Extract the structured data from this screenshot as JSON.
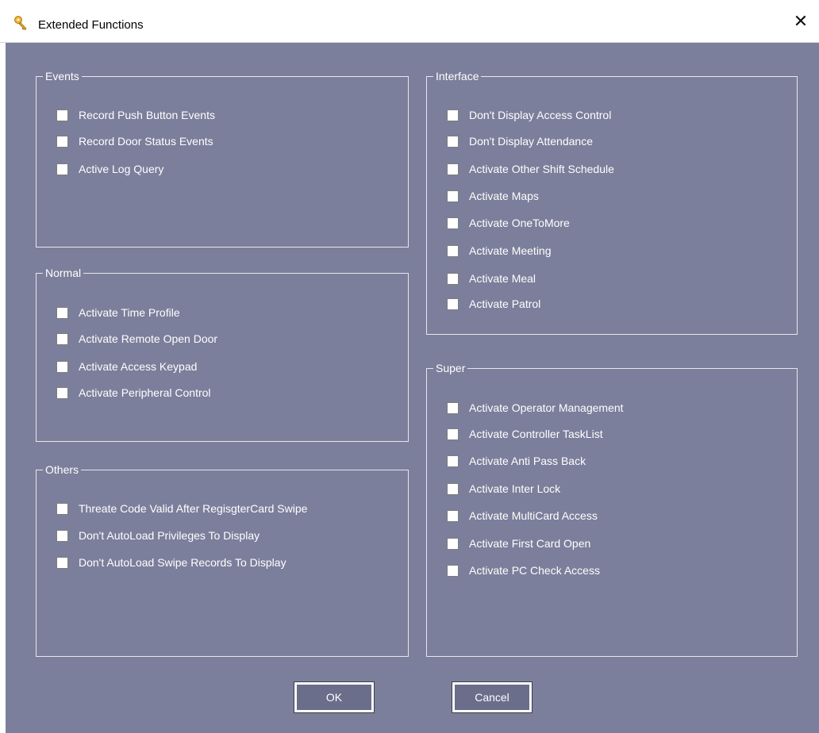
{
  "window": {
    "title": "Extended Functions",
    "close_glyph": "✕"
  },
  "groups": {
    "events": {
      "title": "Events",
      "items": [
        {
          "label": "Record Push Button Events",
          "checked": false
        },
        {
          "label": "Record Door Status Events",
          "checked": false
        },
        {
          "label": "Active Log Query",
          "checked": false
        }
      ]
    },
    "normal": {
      "title": "Normal",
      "items": [
        {
          "label": "Activate Time Profile",
          "checked": false
        },
        {
          "label": "Activate Remote Open Door",
          "checked": false
        },
        {
          "label": "Activate Access Keypad",
          "checked": false
        },
        {
          "label": "Activate Peripheral Control",
          "checked": false
        }
      ]
    },
    "others": {
      "title": "Others",
      "items": [
        {
          "label": "Threate Code Valid After RegisgterCard Swipe",
          "checked": false
        },
        {
          "label": "Don't AutoLoad Privileges To Display",
          "checked": false
        },
        {
          "label": "Don't AutoLoad Swipe Records To Display",
          "checked": false
        }
      ]
    },
    "interface": {
      "title": "Interface",
      "items": [
        {
          "label": "Don't Display Access Control",
          "checked": false
        },
        {
          "label": "Don't Display Attendance",
          "checked": false
        },
        {
          "label": "Activate Other Shift Schedule",
          "checked": false
        },
        {
          "label": "Activate Maps",
          "checked": false
        },
        {
          "label": "Activate OneToMore",
          "checked": false
        },
        {
          "label": "Activate Meeting",
          "checked": false
        },
        {
          "label": "Activate Meal",
          "checked": false
        },
        {
          "label": "Activate Patrol",
          "checked": false
        }
      ]
    },
    "super": {
      "title": "Super",
      "items": [
        {
          "label": "Activate Operator Management",
          "checked": false
        },
        {
          "label": "Activate Controller TaskList",
          "checked": false
        },
        {
          "label": "Activate Anti Pass Back",
          "checked": false
        },
        {
          "label": "Activate Inter Lock",
          "checked": false
        },
        {
          "label": "Activate MultiCard Access",
          "checked": false
        },
        {
          "label": "Activate First Card Open",
          "checked": false
        },
        {
          "label": "Activate PC Check Access",
          "checked": false
        }
      ]
    }
  },
  "buttons": {
    "ok_label": "OK",
    "cancel_label": "Cancel"
  },
  "colors": {
    "client_bg": "#7b7f9b",
    "button_bg": "#6a6e8b"
  },
  "icons": {
    "app": "key-icon",
    "close": "close-icon"
  }
}
